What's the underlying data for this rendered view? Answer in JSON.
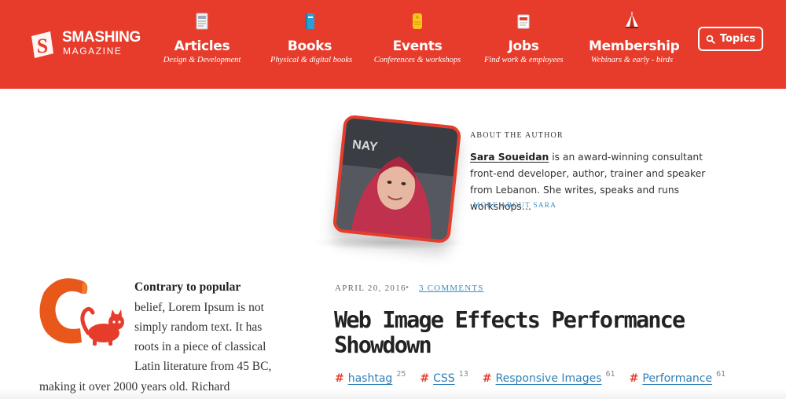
{
  "colors": {
    "brand": "#e73c2b",
    "link": "#3d8fc4",
    "text": "#333333"
  },
  "header": {
    "logo": {
      "line1": "SMASHING",
      "line2": "MAGAZINE",
      "icon": "smashing-s-logo"
    },
    "nav": [
      {
        "label": "Articles",
        "sub": "Design & Development",
        "icon": "article-icon"
      },
      {
        "label": "Books",
        "sub": "Physical & digital books",
        "icon": "book-icon"
      },
      {
        "label": "Events",
        "sub": "Conferences & workshops",
        "icon": "ticket-icon"
      },
      {
        "label": "Jobs",
        "sub": "Find work & employees",
        "icon": "job-icon"
      },
      {
        "label": "Membership",
        "sub": "Webinars & early - birds",
        "icon": "tent-icon"
      }
    ],
    "topics": {
      "label": "Topics",
      "icon": "search-icon"
    }
  },
  "author": {
    "section_label": "ABOUT THE AUTHOR",
    "name": "Sara Soueidan",
    "bio": " is an award-winning consultant front-end developer, author, trainer and speaker from Lebanon. She writes, speaks and runs workshops…",
    "more_link": "MORE ABOUT SARA"
  },
  "intro": {
    "bold": "Contrary to popular",
    "lines": [
      "belief, Lorem Ipsum is not",
      "simply random text. It has",
      "roots in a piece of classical",
      "Latin literature from 45 BC,",
      "making it over 2000 years old. Richard"
    ]
  },
  "article": {
    "date": "APRIL 20, 2016",
    "separator": "•",
    "comments": "3 COMMENTS",
    "title": "Web Image Effects Performance Showdown",
    "tags": [
      {
        "hash": "#",
        "name": "hashtag",
        "count": "25"
      },
      {
        "hash": "#",
        "name": "CSS",
        "count": "13"
      },
      {
        "hash": "#",
        "name": "Responsive Images",
        "count": "61"
      },
      {
        "hash": "#",
        "name": "Performance",
        "count": "61"
      }
    ]
  }
}
